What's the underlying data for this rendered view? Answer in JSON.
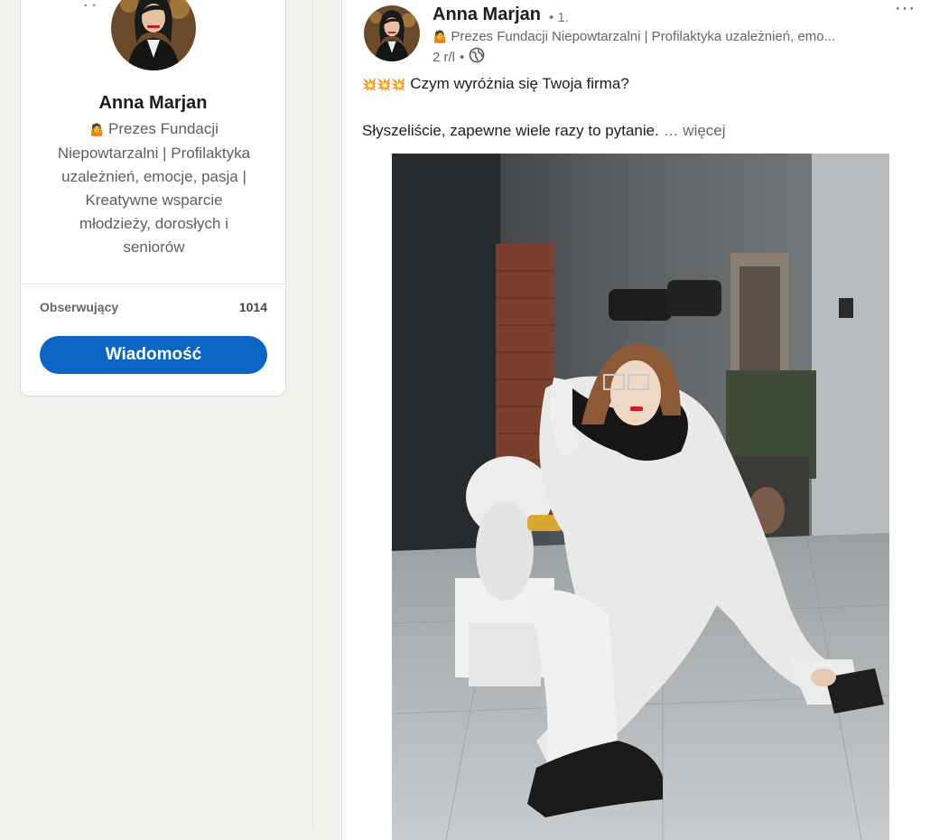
{
  "profile": {
    "banner_script": "sa",
    "name": "Anna Marjan",
    "headline_emoji": "🤷",
    "headline": "Prezes Fundacji Niepowtarzalni | Profilaktyka uzależnień, emocje, pasja | Kreatywne wsparcie młodzieży, dorosłych i seniorów",
    "followers_label": "Obserwujący",
    "followers_count": "1014",
    "message_button": "Wiadomość"
  },
  "post": {
    "author": "Anna Marjan",
    "degree": "• 1.",
    "headline_emoji": "🤷",
    "headline": "Prezes Fundacji Niepowtarzalni | Profilaktyka uzależnień, emo...",
    "time": "2 r/l",
    "time_sep": "•",
    "visibility_icon": "globe-icon",
    "more_label": "···",
    "emojis": "💥💥💥",
    "text_line1": "Czym wyróżnia się Twoja firma?",
    "text_line2": "Słyszeliście, zapewne wiele razy to pytanie.",
    "see_more": "… więcej"
  },
  "colors": {
    "accent": "#0a66c2",
    "page_bg": "#f3f2ef"
  }
}
